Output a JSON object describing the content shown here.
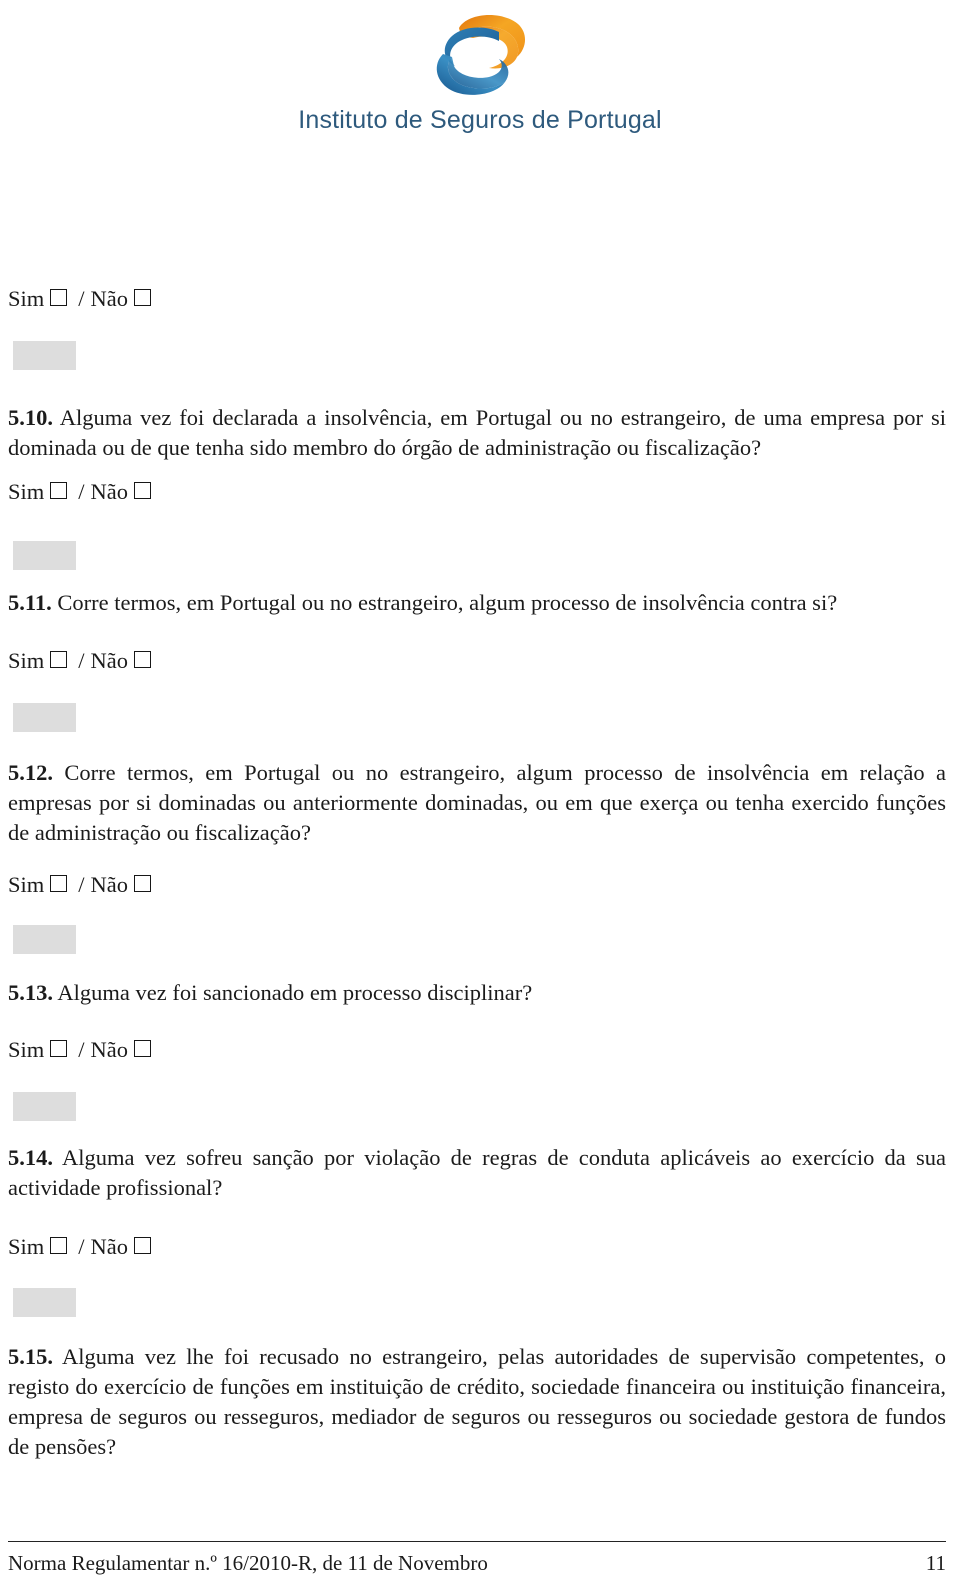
{
  "logo": {
    "icon_name": "isp-sphere-s-logo",
    "wordmark": "Instituto de Seguros de Portugal",
    "colors": {
      "orange_light": "#f5a623",
      "orange_dark": "#e2760f",
      "blue_light": "#3a8fc4",
      "blue_dark": "#1c5e96",
      "wordmark": "#2e5a7d"
    }
  },
  "answer": {
    "yes_label": "Sim",
    "separator": "/",
    "no_label": "Não"
  },
  "gray_field_color": "#dddddd",
  "questions": [
    {
      "id": "5.10",
      "number": "5.10.",
      "text": "Alguma vez foi declarada a insolvência, em Portugal ou no estrangeiro, de uma empresa por si dominada ou de que tenha sido membro do órgão de administração ou fiscalização?"
    },
    {
      "id": "5.11",
      "number": "5.11.",
      "text": "Corre termos, em Portugal ou no estrangeiro, algum processo de insolvência contra si?"
    },
    {
      "id": "5.12",
      "number": "5.12.",
      "text": "Corre termos, em Portugal ou no estrangeiro, algum processo de insolvência em relação a empresas por si dominadas ou anteriormente dominadas, ou em que exerça ou tenha exercido funções de administração ou fiscalização?"
    },
    {
      "id": "5.13",
      "number": "5.13.",
      "text": "Alguma vez foi sancionado em processo disciplinar?"
    },
    {
      "id": "5.14",
      "number": "5.14.",
      "text": "Alguma vez sofreu sanção por violação de regras de conduta aplicáveis ao exercício da sua actividade profissional?"
    },
    {
      "id": "5.15",
      "number": "5.15.",
      "text": "Alguma vez lhe foi recusado no estrangeiro, pelas autoridades de supervisão competentes, o registo do exercício de funções em instituição de crédito, sociedade financeira ou instituição financeira, empresa de seguros ou resseguros, mediador de seguros ou resseguros ou sociedade gestora de fundos de pensões?"
    }
  ],
  "footer": {
    "reference": "Norma Regulamentar n.º 16/2010-R, de 11 de Novembro",
    "page_number": "11"
  }
}
